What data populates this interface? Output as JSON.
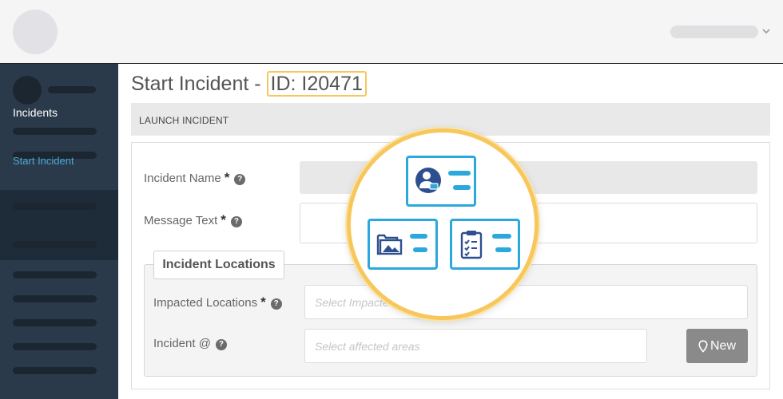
{
  "page": {
    "title_prefix": "Start Incident - ",
    "title_id": "ID: I20471"
  },
  "sidebar": {
    "incidents_label": "Incidents",
    "start_incident_label": "Start Incident"
  },
  "section": {
    "label": "LAUNCH INCIDENT"
  },
  "form": {
    "incident_name_label": "Incident Name",
    "message_text_label": "Message Text",
    "required_mark": "*",
    "help_glyph": "?",
    "incident_name_value": "",
    "message_text_value": ""
  },
  "locations": {
    "legend": "Incident Locations",
    "impacted_label": "Impacted Locations",
    "impacted_placeholder": "Select Impacted",
    "incident_at_label": "Incident @",
    "incident_at_placeholder": "Select affected areas",
    "new_button_label": "New"
  },
  "colors": {
    "accent_blue": "#2ba8dc",
    "highlight_yellow": "#f7c75c",
    "sidebar_bg": "#2b3a4a",
    "active_link": "#4aa8d8"
  },
  "icons": {
    "user_menu": "chevron-down-icon",
    "new_button": "map-marker-icon",
    "help": "question-circle-icon"
  }
}
